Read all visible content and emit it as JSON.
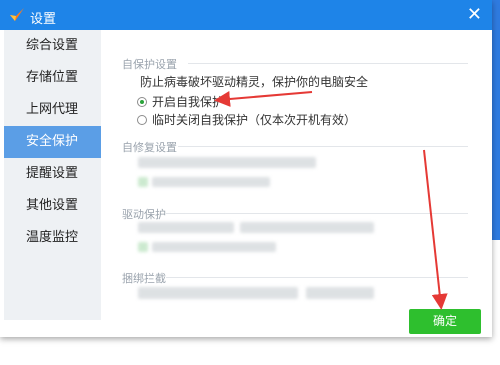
{
  "window": {
    "title": "设置",
    "close_symbol": "✕"
  },
  "sidebar": {
    "items": [
      {
        "label": "综合设置"
      },
      {
        "label": "存储位置"
      },
      {
        "label": "上网代理"
      },
      {
        "label": "安全保护",
        "active": true
      },
      {
        "label": "提醒设置"
      },
      {
        "label": "其他设置"
      },
      {
        "label": "温度监控"
      }
    ]
  },
  "main": {
    "self_protect": {
      "title": "自保护设置",
      "description": "防止病毒破坏驱动精灵，保护你的电脑安全",
      "options": [
        {
          "label": "开启自我保护",
          "checked": true
        },
        {
          "label": "临时关闭自我保护（仅本次开机有效）",
          "checked": false
        }
      ]
    },
    "self_repair": {
      "title": "自修复设置"
    },
    "driver_protect": {
      "title": "驱动保护"
    },
    "bundle_block": {
      "title": "捆绑拦截"
    }
  },
  "footer": {
    "ok_label": "确定"
  },
  "colors": {
    "titlebar": "#1e84e8",
    "active_nav": "#5b9ee6",
    "ok_button": "#2ebf2e",
    "annotation": "#e53935"
  },
  "icons": {
    "logo": "checkmark-logo-icon",
    "close": "close-icon"
  }
}
